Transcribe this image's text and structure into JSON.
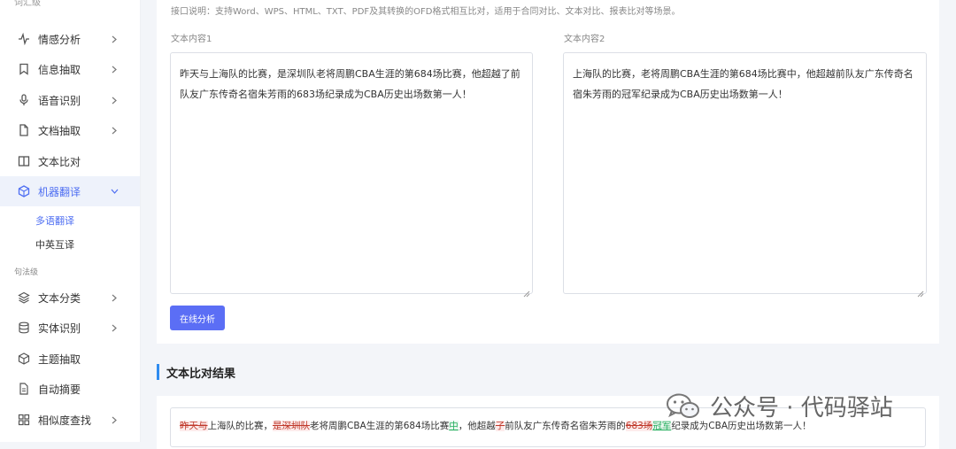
{
  "sidebar": {
    "top_section_label": "词汇级",
    "items": [
      {
        "label": "情感分析",
        "icon": "activity-icon"
      },
      {
        "label": "信息抽取",
        "icon": "bookmark-icon"
      },
      {
        "label": "语音识别",
        "icon": "microphone-icon"
      },
      {
        "label": "文档抽取",
        "icon": "document-icon"
      },
      {
        "label": "文本比对",
        "icon": "columns-icon"
      },
      {
        "label": "机器翻译",
        "icon": "cube-icon"
      }
    ],
    "sub_items": [
      {
        "label": "多语翻译"
      },
      {
        "label": "中英互译"
      }
    ],
    "section2_label": "句法级",
    "items2": [
      {
        "label": "文本分类",
        "icon": "layers-icon"
      },
      {
        "label": "实体识别",
        "icon": "database-icon"
      },
      {
        "label": "主题抽取",
        "icon": "box-icon"
      },
      {
        "label": "自动摘要",
        "icon": "file-text-icon"
      },
      {
        "label": "相似度查找",
        "icon": "grid-icon"
      }
    ]
  },
  "main": {
    "description": "接口说明：支持Word、WPS、HTML、TXT、PDF及其转换的OFD格式相互比对，适用于合同对比、文本对比、报表比对等场景。",
    "text1_label": "文本内容1",
    "text2_label": "文本内容2",
    "text1_value": "昨天与上海队的比赛，是深圳队老将周鹏CBA生涯的第684场比赛，他超越了前队友广东传奇名宿朱芳雨的683场纪录成为CBA历史出场数第一人！",
    "text2_value": "上海队的比赛，老将周鹏CBA生涯的第684场比赛中，他超越前队友广东传奇名宿朱芳雨的冠军纪录成为CBA历史出场数第一人！",
    "analyze_button": "在线分析",
    "result_title": "文本比对结果",
    "result_segments": [
      {
        "text": "昨天与",
        "type": "del"
      },
      {
        "text": "上海队的比赛，",
        "type": "same"
      },
      {
        "text": "是深圳队",
        "type": "del"
      },
      {
        "text": "老将周鹏CBA生涯的第684场比赛",
        "type": "same"
      },
      {
        "text": "中",
        "type": "ins"
      },
      {
        "text": "，他超越",
        "type": "same"
      },
      {
        "text": "了",
        "type": "del"
      },
      {
        "text": "前队友广东传奇名宿朱芳雨的",
        "type": "same"
      },
      {
        "text": "683场",
        "type": "del"
      },
      {
        "text": "冠军",
        "type": "ins"
      },
      {
        "text": "纪录成为CBA历史出场数第一人！",
        "type": "same"
      }
    ]
  },
  "watermark": {
    "text": "公众号 · 代码驿站",
    "icon": "wechat-icon"
  },
  "colors": {
    "accent": "#4e6ef2",
    "button": "#5b6ef5",
    "result_bar": "#2f8cf0"
  }
}
